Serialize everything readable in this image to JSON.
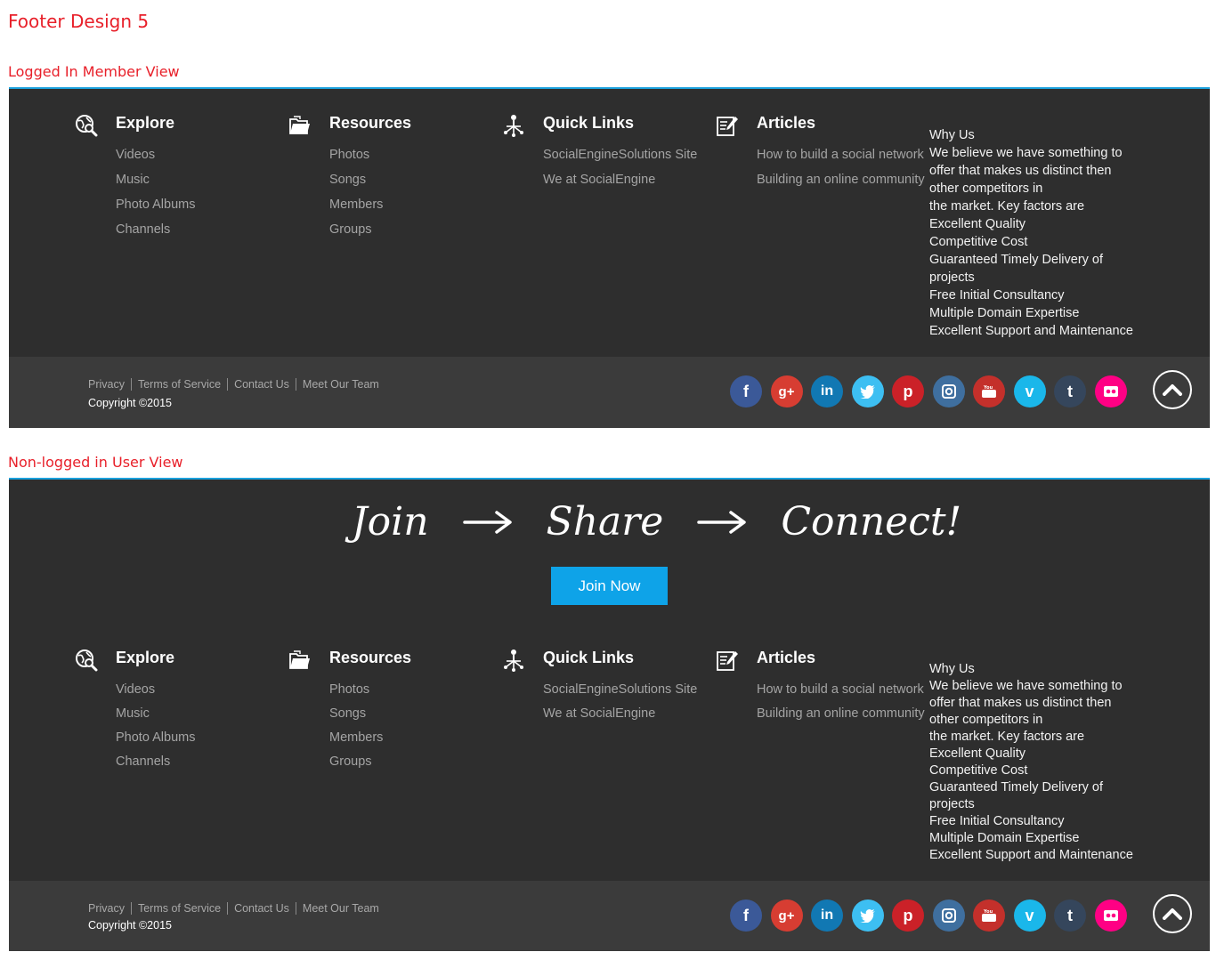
{
  "page_title": "Footer Design 5",
  "views": {
    "member": {
      "label": "Logged In Member View"
    },
    "guest": {
      "label": "Non-logged in User View"
    }
  },
  "hero": {
    "words": [
      "Join",
      "Share",
      "Connect!"
    ],
    "join_button": "Join Now"
  },
  "columns": {
    "explore": {
      "title": "Explore",
      "icon": "globe-search-icon",
      "items": [
        "Videos",
        "Music",
        "Photo Albums",
        "Channels"
      ]
    },
    "resources": {
      "title": "Resources",
      "icon": "folder-icon",
      "items": [
        "Photos",
        "Songs",
        "Members",
        "Groups"
      ]
    },
    "quicklinks": {
      "title": "Quick Links",
      "icon": "network-icon",
      "items": [
        "SocialEngineSolutions Site",
        "We at SocialEngine"
      ]
    },
    "articles": {
      "title": "Articles",
      "icon": "article-edit-icon",
      "items": [
        "How to build a social network",
        "Building an online community"
      ]
    }
  },
  "why_us": {
    "lines": [
      "Why Us",
      "We believe we have something to",
      "offer that makes us distinct then",
      "other competitors in",
      "the market. Key factors are",
      "Excellent Quality",
      "Competitive Cost",
      "Guaranteed Timely Delivery of",
      "projects",
      "Free Initial Consultancy",
      "Multiple Domain Expertise",
      "Excellent Support and Maintenance"
    ]
  },
  "bottom": {
    "links": [
      "Privacy",
      "Terms of Service",
      "Contact Us",
      "Meet Our Team"
    ],
    "copyright": "Copyright ©2015",
    "back_to_top_icon": "chevron-up-icon"
  },
  "socials": [
    {
      "name": "facebook",
      "icon": "facebook-icon",
      "color": "#3b5998"
    },
    {
      "name": "google-plus",
      "icon": "google-plus-icon",
      "color": "#d73d32"
    },
    {
      "name": "linkedin",
      "icon": "linkedin-icon",
      "color": "#1178b3"
    },
    {
      "name": "twitter",
      "icon": "twitter-icon",
      "color": "#3dbff2"
    },
    {
      "name": "pinterest",
      "icon": "pinterest-icon",
      "color": "#cb2128"
    },
    {
      "name": "instagram",
      "icon": "instagram-icon",
      "color": "#3f6f9f"
    },
    {
      "name": "youtube",
      "icon": "youtube-icon",
      "color": "#c4302b"
    },
    {
      "name": "vimeo",
      "icon": "vimeo-icon",
      "color": "#1ab7ea"
    },
    {
      "name": "tumblr",
      "icon": "tumblr-icon",
      "color": "#35465c"
    },
    {
      "name": "flickr",
      "icon": "flickr-icon",
      "color": "#ff0084"
    }
  ],
  "colors": {
    "accent_red": "#e8202a",
    "footer_bg": "#2e2e2e",
    "bottom_bar_bg": "#3b3b3b",
    "top_border": "#1aa0dc",
    "join_button": "#0ea3e8"
  }
}
